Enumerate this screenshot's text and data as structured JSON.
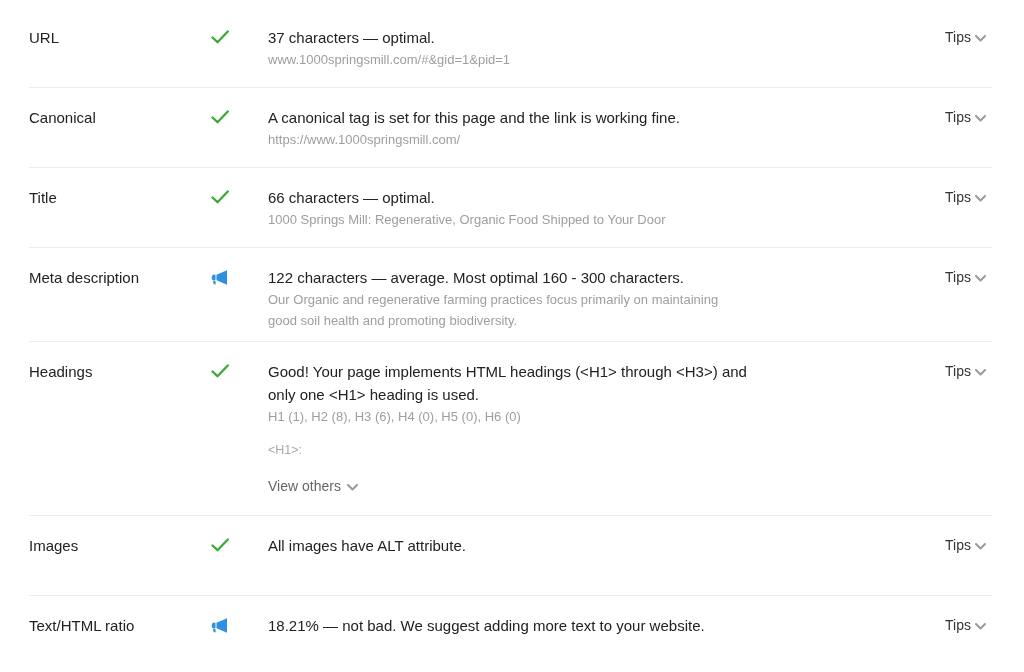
{
  "checks": [
    {
      "label": "URL",
      "kind": "pass",
      "summary": "37 characters — optimal.",
      "details": [
        "www.1000springsmill.com/#&gid=1&pid=1"
      ],
      "tips": {
        "label": "Tips",
        "expanded": false
      }
    },
    {
      "label": "Canonical",
      "kind": "pass",
      "summary": "A canonical tag is set for this page and the link is working fine.",
      "details": [
        "https://www.1000springsmill.com/"
      ],
      "tips": {
        "label": "Tips",
        "expanded": false
      }
    },
    {
      "label": "Title",
      "kind": "pass",
      "summary": "66 characters — optimal.",
      "details": [
        "1000 Springs Mill: Regenerative, Organic Food Shipped to Your Door"
      ],
      "tips": {
        "label": "Tips",
        "expanded": false
      }
    },
    {
      "label": "Meta description",
      "kind": "notice",
      "summary": "122 characters — average. Most optimal 160 - 300 characters.",
      "details": [
        "Our Organic and regenerative farming practices focus primarily on maintaining good soil health and promoting biodiversity."
      ],
      "tips": {
        "label": "Tips",
        "expanded": false
      }
    },
    {
      "label": "Headings",
      "kind": "pass",
      "summary": "Good! Your page implements HTML headings (<H1> through <H3>) and only one <H1> heading is used.",
      "details": [
        "H1 (1), H2 (8), H3 (6), H4 (0), H5 (0), H6 (0)"
      ],
      "note": "<H1>:",
      "view_others": {
        "label": "View others",
        "expanded": false
      },
      "tips": {
        "label": "Tips",
        "expanded": false
      }
    },
    {
      "label": "Images",
      "kind": "pass",
      "summary": "All images have ALT attribute.",
      "tips": {
        "label": "Tips",
        "expanded": false
      }
    },
    {
      "label": "Text/HTML ratio",
      "kind": "notice",
      "summary": "18.21% — not bad. We suggest adding more text to your website.",
      "tips": {
        "label": "Tips",
        "expanded": false
      }
    }
  ]
}
